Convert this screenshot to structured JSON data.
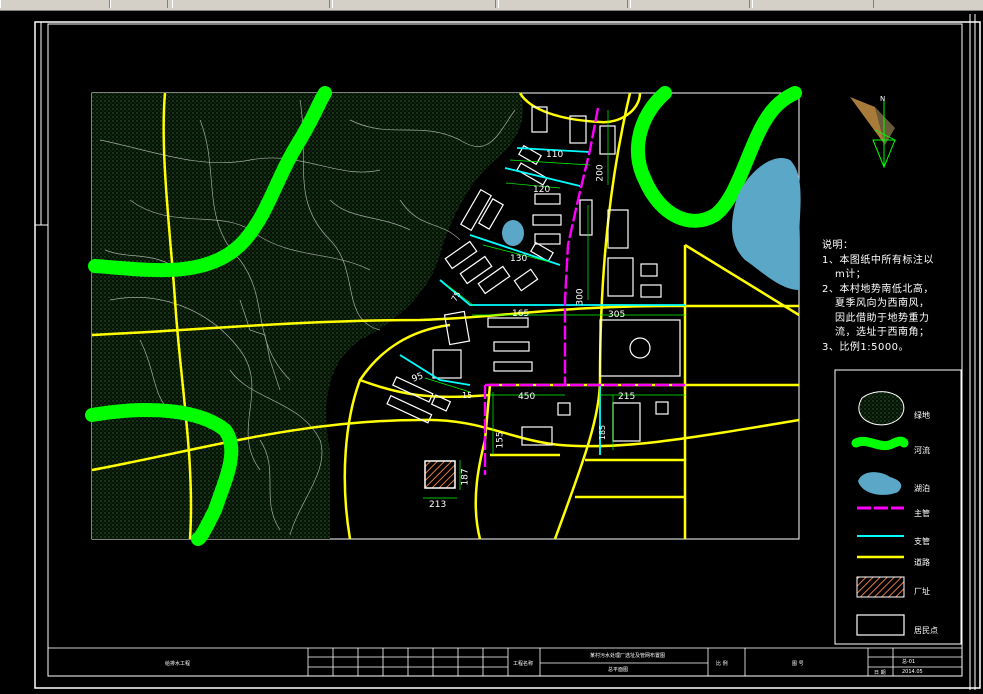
{
  "window": {
    "toolbar_segments": 7
  },
  "map": {
    "north_label": "N",
    "dimensions": [
      "110",
      "120",
      "130",
      "200",
      "300",
      "165",
      "305",
      "95",
      "450",
      "215",
      "155",
      "187",
      "213",
      "75",
      "185",
      "15"
    ]
  },
  "notes": {
    "heading": "说明：",
    "line1": "1、本图纸中所有标注以",
    "line1b": "m计；",
    "line2": "2、本村地势南低北高，",
    "line2b": "夏季风向为西南风，",
    "line2c": "因此借助于地势重力",
    "line2d": "流，选址于西南角；",
    "line3": "3、比例1:5000。"
  },
  "legend": {
    "items": [
      {
        "label": "绿地",
        "icon": "woodland-icon"
      },
      {
        "label": "河流",
        "icon": "river-icon"
      },
      {
        "label": "湖泊",
        "icon": "lake-icon"
      },
      {
        "label": "主管",
        "icon": "main-pipe-icon"
      },
      {
        "label": "支管",
        "icon": "branch-pipe-icon"
      },
      {
        "label": "道路",
        "icon": "road-icon"
      },
      {
        "label": "厂址",
        "icon": "plant-site-icon"
      },
      {
        "label": "居民点",
        "icon": "residential-icon"
      }
    ]
  },
  "title_block": {
    "left_title": "给排水工程",
    "school": "工程名称",
    "project": "某村污水处理厂选址及管网布置图",
    "drawing_name": "总平面图",
    "scale_label": "比 例",
    "drawing_no_label": "图 号",
    "drawing_no": "总-01",
    "date_label": "日 期",
    "date": "2014.05"
  },
  "colors": {
    "green_river": "#00ff00",
    "road": "#ffff00",
    "main_pipe": "#ff00ff",
    "branch_pipe": "#00ffff",
    "lake": "#5aa7c8",
    "woodland": "#1a2a1a"
  }
}
